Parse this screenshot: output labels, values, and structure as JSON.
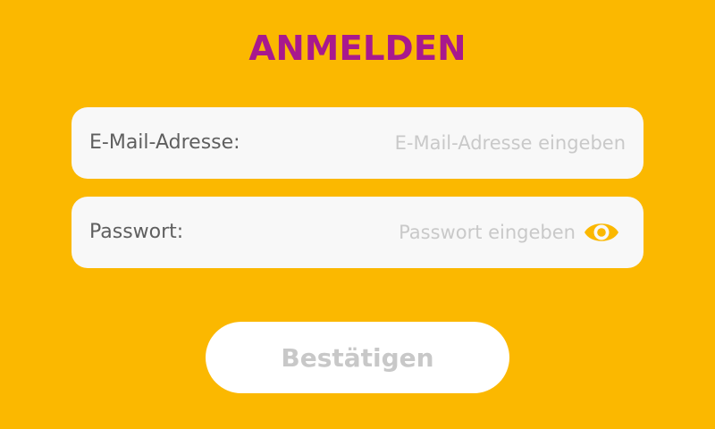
{
  "title": "ANMELDEN",
  "email": {
    "label": "E-Mail-Adresse:",
    "placeholder": "E-Mail-Adresse eingeben",
    "value": ""
  },
  "password": {
    "label": "Passwort:",
    "placeholder": "Passwort eingeben",
    "value": "",
    "toggle_icon": "eye-icon"
  },
  "submit": {
    "label": "Bestätigen",
    "enabled": false
  },
  "colors": {
    "background": "#FBB800",
    "title": "#A8198E",
    "field_bg": "#F8F8F8",
    "label_text": "#5F5F5F",
    "placeholder_text": "#C9C9C9",
    "icon": "#FBB800",
    "button_bg": "#FFFFFF",
    "button_text_disabled": "#C8C8C8"
  }
}
